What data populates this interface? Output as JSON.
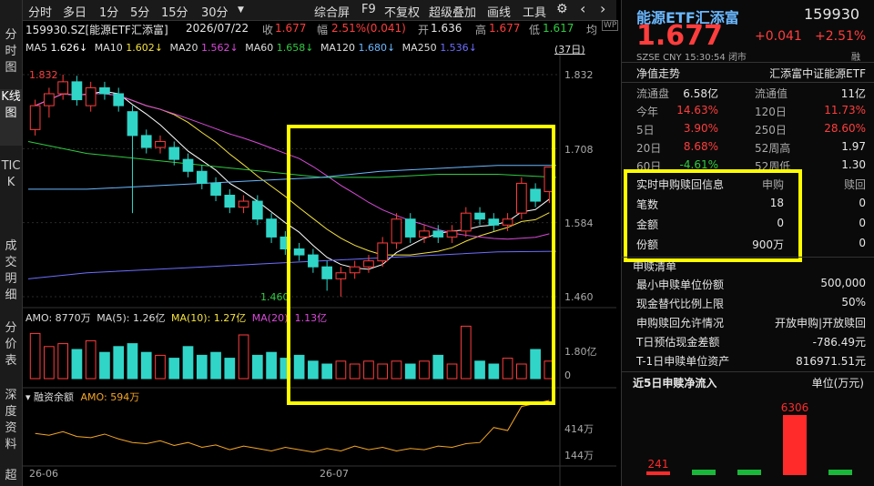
{
  "left_rail": [
    {
      "label": "分时图",
      "active": false
    },
    {
      "label": "K线图",
      "active": true
    },
    {
      "label": "TICK",
      "active": false
    },
    {
      "label": "成交明细",
      "active": false
    },
    {
      "label": "分价表",
      "active": false
    },
    {
      "label": "深度资料",
      "active": false
    },
    {
      "label": "超",
      "active": false
    }
  ],
  "toolbar": {
    "periods": [
      "分时",
      "多日",
      "1分",
      "5分",
      "15分",
      "30分"
    ],
    "period_menu_arrow": "▼",
    "tools": [
      "综合屏",
      "F9",
      "不复权",
      "超级叠加",
      "画线",
      "工具"
    ],
    "settings_icon": "⚙",
    "back_icon": "‹",
    "forward_icon": "›"
  },
  "info_bar": {
    "code_name": "159930.SZ[能源ETF汇添富]",
    "date": "2026/07/22",
    "close_label": "收",
    "close_value": "1.677",
    "range_label": "幅",
    "range_value": "2.51%(0.041)",
    "open_label": "开",
    "open_value": "1.636",
    "high_label": "高",
    "high_value": "1.677",
    "low_label": "低",
    "low_value": "1.617",
    "avg_label": "均"
  },
  "ma_bar": [
    {
      "label": "MA5",
      "value": "1.626",
      "color": "#ffffff"
    },
    {
      "label": "MA10",
      "value": "1.602",
      "color": "#f5e23c"
    },
    {
      "label": "MA20",
      "value": "1.562",
      "color": "#d94ad9"
    },
    {
      "label": "MA60",
      "value": "1.658",
      "color": "#2ecc40"
    },
    {
      "label": "MA120",
      "value": "1.680",
      "color": "#6ab8ff"
    },
    {
      "label": "MA250",
      "value": "1.536",
      "color": "#6d6dff"
    }
  ],
  "days_badge": "(37日)",
  "price_axis": [
    "1.832",
    "1.708",
    "1.584",
    "1.460"
  ],
  "chart_marks": {
    "high_marker": "1.832",
    "low_marker": "1.460"
  },
  "amo_legend": {
    "amo": "AMO: 8770万",
    "ma5": "MA(5): 1.26亿",
    "ma10": "MA(10): 1.27亿",
    "ma20": "MA(20): 1.13亿"
  },
  "volume_axis": [
    "1.80亿",
    "0"
  ],
  "margin_legend": {
    "title": "融资余额",
    "amo": "AMO: 594万"
  },
  "margin_axis": [
    "414万",
    "144万"
  ],
  "date_axis": [
    "26-06",
    "26-07"
  ],
  "colors": {
    "up": "#ff3d3d",
    "down": "#30d5c8",
    "highlight": "#ffff00",
    "flow_up": "#ff2a2a",
    "flow_down": "#19b83a"
  },
  "quote": {
    "name": "能源ETF汇添富",
    "code": "159930",
    "price": "1.677",
    "change": "+0.041",
    "change_pct": "+2.51%",
    "market": "SZSE",
    "currency": "CNY",
    "time": "15:30:54",
    "status": "闭市",
    "margin_tag": "融"
  },
  "nav_row": {
    "left": "净值走势",
    "right": "汇添富中证能源ETF"
  },
  "stats": [
    {
      "l1": "流通盘",
      "v1": "6.58亿",
      "c1": "white",
      "l2": "流通值",
      "v2": "11亿",
      "c2": "white"
    },
    {
      "l1": "今年",
      "v1": "14.63%",
      "c1": "red",
      "l2": "120日",
      "v2": "11.73%",
      "c2": "red"
    },
    {
      "l1": "5日",
      "v1": "3.90%",
      "c1": "red",
      "l2": "250日",
      "v2": "28.60%",
      "c2": "red"
    },
    {
      "l1": "20日",
      "v1": "8.68%",
      "c1": "red",
      "l2": "52周高",
      "v2": "1.97",
      "c2": "white"
    },
    {
      "l1": "60日",
      "v1": "-4.61%",
      "c1": "green",
      "l2": "52周低",
      "v2": "1.30",
      "c2": "white"
    }
  ],
  "realtime": {
    "headers": [
      "实时申购赎回信息",
      "申购",
      "赎回"
    ],
    "rows": [
      {
        "label": "笔数",
        "sub": "18",
        "red": "0"
      },
      {
        "label": "金额",
        "sub": "0",
        "red": "0"
      },
      {
        "label": "份额",
        "sub": "900万",
        "red": "0"
      }
    ]
  },
  "subscription": {
    "title": "申赎清单",
    "rows": [
      {
        "label": "最小申赎单位份额",
        "value": "500,000"
      },
      {
        "label": "现金替代比例上限",
        "value": "50%"
      },
      {
        "label": "申购赎回允许情况",
        "value": "开放申购|开放赎回"
      },
      {
        "label": "T日预估现金差额",
        "value": "-786.49元"
      },
      {
        "label": "T-1日申赎单位资产",
        "value": "816971.51元"
      }
    ]
  },
  "flow": {
    "title": "近5日申赎净流入",
    "unit": "单位(万元)",
    "chart_data": {
      "type": "bar",
      "values": [
        241,
        -20,
        -15,
        6306,
        -20
      ],
      "labels": [
        "241",
        "",
        "",
        "6306",
        ""
      ]
    }
  },
  "candles": [
    [
      1.74,
      1.78,
      1.79,
      1.73
    ],
    [
      1.78,
      1.8,
      1.81,
      1.76
    ],
    [
      1.8,
      1.82,
      1.832,
      1.79
    ],
    [
      1.82,
      1.79,
      1.83,
      1.78
    ],
    [
      1.78,
      1.81,
      1.82,
      1.77
    ],
    [
      1.81,
      1.8,
      1.82,
      1.79
    ],
    [
      1.8,
      1.78,
      1.81,
      1.77
    ],
    [
      1.77,
      1.73,
      1.78,
      1.6
    ],
    [
      1.73,
      1.71,
      1.74,
      1.7
    ],
    [
      1.71,
      1.72,
      1.73,
      1.7
    ],
    [
      1.71,
      1.69,
      1.72,
      1.68
    ],
    [
      1.69,
      1.67,
      1.7,
      1.66
    ],
    [
      1.67,
      1.65,
      1.68,
      1.64
    ],
    [
      1.65,
      1.63,
      1.66,
      1.62
    ],
    [
      1.63,
      1.61,
      1.64,
      1.6
    ],
    [
      1.61,
      1.62,
      1.63,
      1.6
    ],
    [
      1.62,
      1.59,
      1.63,
      1.58
    ],
    [
      1.59,
      1.56,
      1.6,
      1.55
    ],
    [
      1.56,
      1.54,
      1.57,
      1.53
    ],
    [
      1.54,
      1.53,
      1.55,
      1.52
    ],
    [
      1.53,
      1.51,
      1.54,
      1.5
    ],
    [
      1.51,
      1.49,
      1.52,
      1.47
    ],
    [
      1.49,
      1.5,
      1.51,
      1.46
    ],
    [
      1.5,
      1.51,
      1.52,
      1.49
    ],
    [
      1.51,
      1.52,
      1.53,
      1.5
    ],
    [
      1.52,
      1.55,
      1.56,
      1.51
    ],
    [
      1.55,
      1.59,
      1.6,
      1.54
    ],
    [
      1.59,
      1.56,
      1.6,
      1.55
    ],
    [
      1.56,
      1.57,
      1.58,
      1.55
    ],
    [
      1.57,
      1.56,
      1.58,
      1.55
    ],
    [
      1.56,
      1.57,
      1.58,
      1.55
    ],
    [
      1.57,
      1.6,
      1.61,
      1.56
    ],
    [
      1.6,
      1.59,
      1.61,
      1.58
    ],
    [
      1.59,
      1.58,
      1.6,
      1.57
    ],
    [
      1.58,
      1.59,
      1.6,
      1.57
    ],
    [
      1.6,
      1.65,
      1.66,
      1.59
    ],
    [
      1.64,
      1.62,
      1.65,
      1.61
    ],
    [
      1.636,
      1.677,
      1.677,
      1.617
    ]
  ],
  "volumes": [
    1.55,
    1.1,
    1.2,
    1.0,
    1.3,
    0.9,
    1.1,
    1.2,
    0.9,
    0.8,
    0.7,
    1.1,
    0.8,
    0.9,
    0.7,
    1.5,
    0.8,
    0.9,
    0.7,
    0.8,
    0.6,
    0.5,
    0.6,
    0.5,
    0.6,
    0.5,
    0.6,
    0.5,
    0.6,
    0.8,
    0.5,
    1.8,
    0.6,
    0.5,
    0.7,
    0.5,
    1.0,
    0.6
  ],
  "margin_series": [
    0.45,
    0.42,
    0.48,
    0.4,
    0.38,
    0.44,
    0.36,
    0.3,
    0.28,
    0.33,
    0.25,
    0.3,
    0.22,
    0.26,
    0.18,
    0.24,
    0.2,
    0.16,
    0.22,
    0.18,
    0.14,
    0.2,
    0.16,
    0.24,
    0.18,
    0.22,
    0.16,
    0.2,
    0.18,
    0.24,
    0.22,
    0.28,
    0.3,
    0.55,
    0.5,
    0.9,
    0.95,
    1.0
  ]
}
